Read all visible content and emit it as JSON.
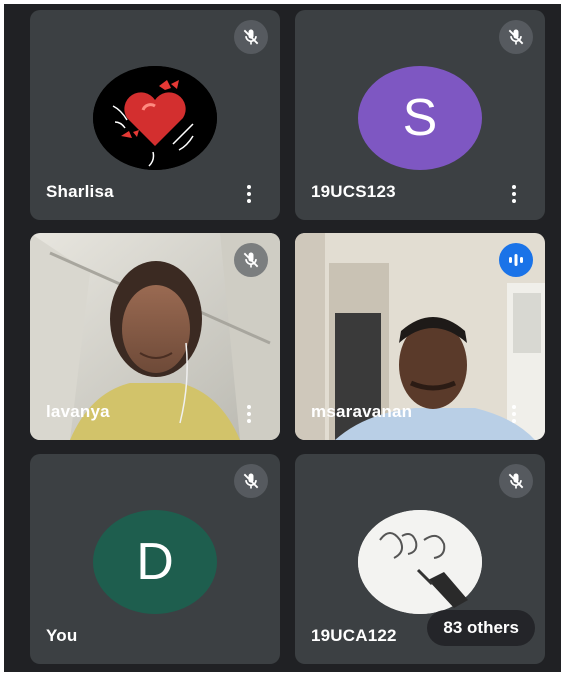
{
  "colors": {
    "background": "#202124",
    "tile": "#3c4043",
    "avatar_s": "#7e57c2",
    "avatar_d": "#1e5e4e",
    "speaking": "#1a73e8"
  },
  "participants": [
    {
      "name": "Sharlisa",
      "muted": true,
      "avatar": "image"
    },
    {
      "name": "19UCS123",
      "muted": true,
      "avatar_letter": "S"
    },
    {
      "name": "lavanya",
      "muted": true,
      "avatar": "video"
    },
    {
      "name": "msaravanan",
      "muted": false,
      "speaking": true,
      "avatar": "video"
    },
    {
      "name": "You",
      "muted": true,
      "avatar_letter": "D"
    },
    {
      "name": "19UCA122",
      "muted": true,
      "avatar": "image"
    }
  ],
  "overflow": {
    "label": "83 others"
  },
  "icons": {
    "mute": "mic-off-icon",
    "speaking": "audio-level-icon",
    "menu": "more-vert-icon"
  }
}
